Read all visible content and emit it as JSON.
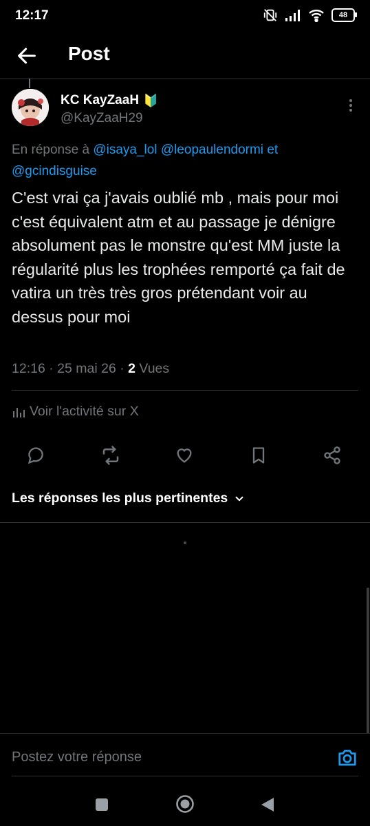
{
  "status_bar": {
    "time": "12:17",
    "battery": "48"
  },
  "header": {
    "title": "Post"
  },
  "post": {
    "author_name": "KC KayZaaH",
    "verified_badge": "🔰",
    "handle": "@KayZaaH29",
    "reply_prefix": "En réponse à",
    "reply_mentions": [
      "@isaya_lol",
      "@leopaulendormi",
      "@gcindisguise"
    ],
    "reply_joiner": "et",
    "text": "C'est vrai ça j'avais oublié mb , mais pour moi c'est équivalent atm et au passage je dénigre absolument pas le monstre qu'est MM juste la régularité plus les trophées remporté ça fait de vatira un très très gros prétendant voir au dessus pour moi",
    "time": "12:16",
    "date": "25 mai 26",
    "views_count": "2",
    "views_label": "Vues"
  },
  "activity_label": "Voir l'activité sur X",
  "actions": [
    "reply-icon",
    "retweet-icon",
    "like-icon",
    "bookmark-icon",
    "share-icon"
  ],
  "sort_label": "Les réponses les plus pertinentes",
  "reply_placeholder": "Postez votre réponse",
  "colors": {
    "link": "#1d9bf0",
    "muted": "#71767b",
    "background": "#000000"
  }
}
